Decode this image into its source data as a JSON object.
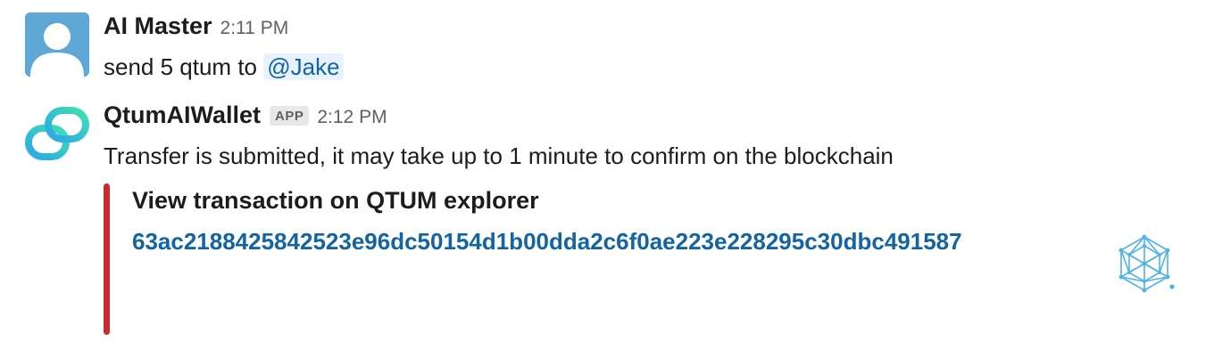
{
  "messages": [
    {
      "sender": "AI Master",
      "time": "2:11 PM",
      "text_prefix": "send 5 qtum to ",
      "mention": "@Jake"
    },
    {
      "sender": "QtumAIWallet",
      "badge": "APP",
      "time": "2:12 PM",
      "text": "Transfer is submitted, it may take up to 1 minute to confirm on the blockchain",
      "attachment": {
        "title": "View transaction on QTUM explorer",
        "link": "63ac2188425842523e96dc50154d1b00dda2c6f0ae223e228295c30dbc491587",
        "accent_color": "#c92a2a",
        "thumb_icon": "qtum-logo-icon"
      }
    }
  ],
  "colors": {
    "link": "#1264a3",
    "mention_bg": "#e8f2fa",
    "avatar_user_bg": "#5fa8d6"
  }
}
